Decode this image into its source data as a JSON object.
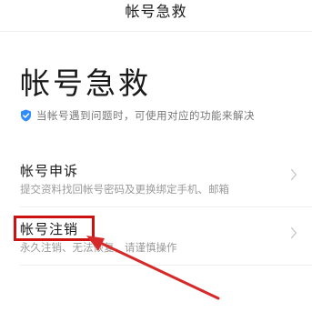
{
  "header": {
    "title": "帐号急救"
  },
  "hero": {
    "title": "帐号急救",
    "subtitle": "当帐号遇到问题时，可使用对应的功能来解决",
    "shield_icon": "shield-check-icon",
    "accent_color": "#2f8cff"
  },
  "menu": {
    "items": [
      {
        "title": "帐号申诉",
        "description": "提交资料找回帐号密码及更换绑定手机、邮箱",
        "icon": "chevron-right-icon"
      },
      {
        "title": "帐号注销",
        "description": "永久注销、无法恢复，请谨慎操作",
        "icon": "chevron-right-icon"
      }
    ]
  },
  "annotation": {
    "color": "#cc1111"
  }
}
